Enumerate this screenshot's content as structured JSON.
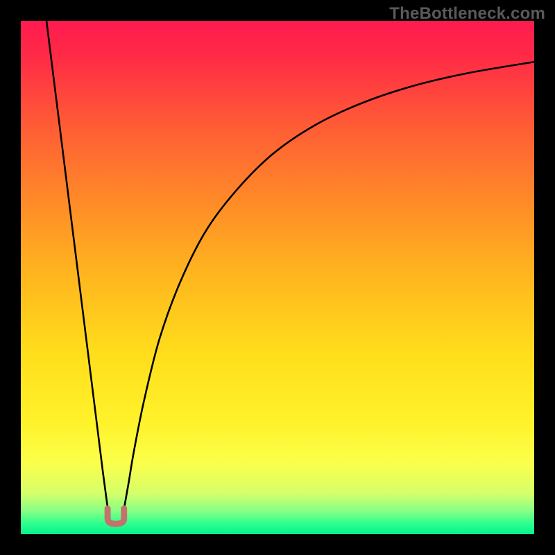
{
  "watermark": "TheBottleneck.com",
  "chart_data": {
    "type": "line",
    "title": "",
    "xlabel": "",
    "ylabel": "",
    "xlim": [
      0,
      100
    ],
    "ylim": [
      0,
      100
    ],
    "background_gradient": {
      "stops": [
        {
          "offset": 0.0,
          "color": "#ff1a4f"
        },
        {
          "offset": 0.07,
          "color": "#ff2b46"
        },
        {
          "offset": 0.2,
          "color": "#ff5a36"
        },
        {
          "offset": 0.35,
          "color": "#ff8a28"
        },
        {
          "offset": 0.5,
          "color": "#ffb71e"
        },
        {
          "offset": 0.65,
          "color": "#ffde1c"
        },
        {
          "offset": 0.78,
          "color": "#fff22a"
        },
        {
          "offset": 0.86,
          "color": "#fbff4a"
        },
        {
          "offset": 0.92,
          "color": "#d6ff6a"
        },
        {
          "offset": 0.955,
          "color": "#86ff84"
        },
        {
          "offset": 0.98,
          "color": "#2cff8e"
        },
        {
          "offset": 1.0,
          "color": "#08f08c"
        }
      ]
    },
    "series": [
      {
        "name": "curve-left-branch",
        "color": "#000000",
        "x": [
          5.0,
          6.0,
          7.0,
          8.0,
          9.0,
          10.0,
          11.0,
          12.0,
          13.0,
          14.0,
          15.0,
          16.0,
          16.8,
          17.4
        ],
        "y": [
          100,
          92,
          84,
          76,
          68,
          60,
          52,
          44,
          36,
          28,
          20,
          12,
          6,
          2.3
        ]
      },
      {
        "name": "curve-right-branch",
        "color": "#000000",
        "x": [
          19.6,
          20.2,
          21,
          22,
          24,
          27,
          31,
          36,
          42,
          49,
          57,
          66,
          76,
          87,
          100
        ],
        "y": [
          2.3,
          5.5,
          10,
          16,
          26,
          38,
          49,
          59,
          67,
          74,
          79.5,
          83.8,
          87.2,
          89.8,
          92
        ]
      }
    ],
    "markers": [
      {
        "name": "trough-marker",
        "shape": "u",
        "color": "#c1736c",
        "cx": 18.5,
        "cy": 2.0,
        "width": 3.2,
        "height": 3.0,
        "stroke_width": 1.2
      }
    ]
  }
}
